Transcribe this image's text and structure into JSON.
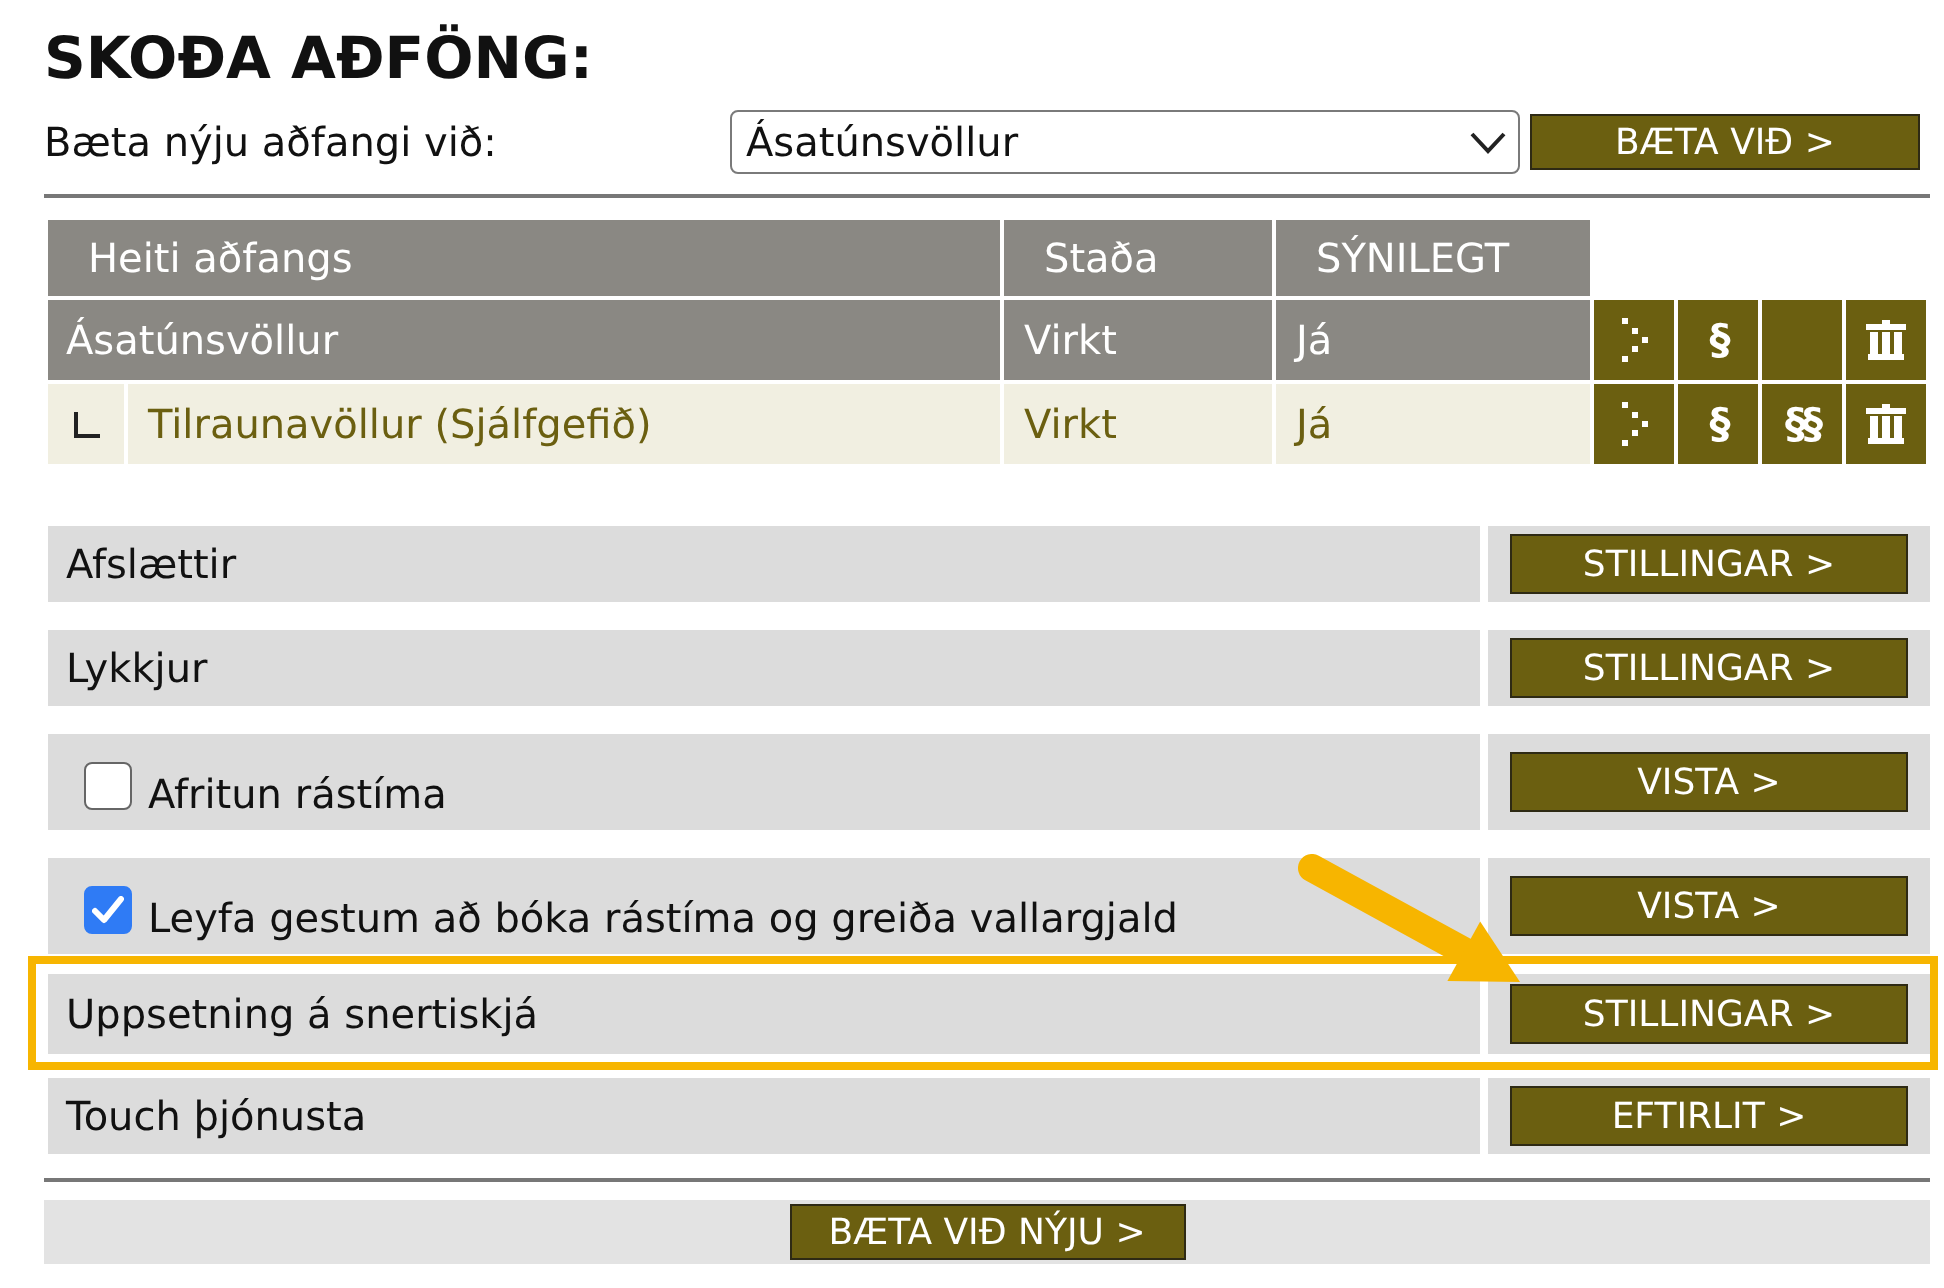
{
  "title": "SKOÐA AÐFÖNG:",
  "add_resource": {
    "label": "Bæta nýju aðfangi við:",
    "select": {
      "value": "Ásatúnsvöllur"
    },
    "button": "BÆTA VIÐ >"
  },
  "table": {
    "columns": [
      "Heiti aðfangs",
      "Staða",
      "SÝNILEGT"
    ],
    "rows": [
      {
        "name": "Ásatúnsvöllur",
        "status": "Virkt",
        "visible": "Já",
        "actions": [
          {
            "kind": "open"
          },
          {
            "kind": "symbol",
            "label": "§"
          },
          {
            "kind": "blank"
          },
          {
            "kind": "delete"
          }
        ],
        "children": [
          {
            "name": "Tilraunavöllur (Sjálfgefið)",
            "status": "Virkt",
            "visible": "Já",
            "actions": [
              {
                "kind": "open"
              },
              {
                "kind": "symbol",
                "label": "§"
              },
              {
                "kind": "symbol",
                "label": "§§"
              },
              {
                "kind": "delete"
              }
            ]
          }
        ]
      }
    ]
  },
  "settings": [
    {
      "kind": "plain",
      "label": "Afslættir",
      "button": "STILLINGAR >",
      "highlighted": false
    },
    {
      "kind": "plain",
      "label": "Lykkjur",
      "button": "STILLINGAR >",
      "highlighted": false
    },
    {
      "kind": "checkbox",
      "label": "Afritun rástíma",
      "checked": false,
      "button": "VISTA >",
      "highlighted": false
    },
    {
      "kind": "checkbox",
      "label": "Leyfa gestum að bóka rástíma og greiða vallargjald",
      "checked": true,
      "button": "VISTA >",
      "highlighted": false
    },
    {
      "kind": "plain",
      "label": "Uppsetning á snertiskjá",
      "button": "STILLINGAR >",
      "highlighted": true
    },
    {
      "kind": "plain",
      "label": "Touch þjónusta",
      "button": "EFTIRLIT >",
      "highlighted": false
    }
  ],
  "footer": {
    "button": "BÆTA VIÐ NÝJU >"
  }
}
